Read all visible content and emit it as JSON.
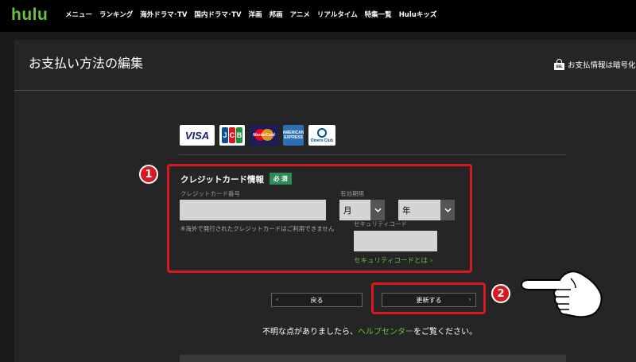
{
  "nav": {
    "logo": "hulu",
    "items": [
      "メニュー",
      "ランキング",
      "海外ドラマ･TV",
      "国内ドラマ･TV",
      "洋画",
      "邦画",
      "アニメ",
      "リアルタイム",
      "特集一覧",
      "Huluキッズ"
    ]
  },
  "page": {
    "title": "お支払い方法の編集",
    "ssl_text": "お支払情報は暗号化",
    "ssl_badge": "SSL"
  },
  "cards": {
    "visa": "VISA",
    "jcb": [
      "J",
      "C",
      "B"
    ],
    "mastercard": "MasterCard",
    "amex": "AMERICAN EXPRESS",
    "diners": "Diners Club"
  },
  "form": {
    "title": "クレジットカード情報",
    "required_badge": "必 須",
    "card_number_label": "クレジットカード番号",
    "card_number_value": "",
    "expiry_label": "有効期限",
    "month_value": "月",
    "year_value": "年",
    "note": "※海外で発行されたクレジットカードはご利用できません",
    "security_label": "セキュリティコード",
    "security_value": "",
    "security_link": "セキュリティコードとは ›"
  },
  "buttons": {
    "back": "戻る",
    "back_arrow": "‹",
    "update": "更新する",
    "update_arrow": "›"
  },
  "help": {
    "before": "不明な点がありましたら、",
    "link": "ヘルプセンター",
    "after": "をご覧ください。"
  },
  "annotations": {
    "badge1": "1",
    "badge2": "2",
    "highlight_color": "#d8191f"
  },
  "colors": {
    "accent": "#66c240",
    "background": "#1a1a1a"
  }
}
